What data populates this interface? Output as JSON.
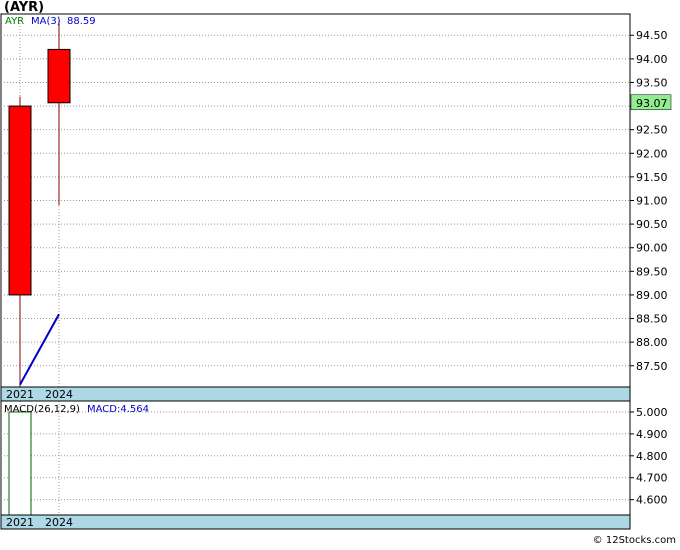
{
  "title": "(AYR)",
  "legend": {
    "ticker": "AYR",
    "ma_label": "MA(3)",
    "ma_value": "88.59",
    "macd_label": "MACD(26,12,9)",
    "macd_value_label": "MACD:4.564"
  },
  "footer": "© 12Stocks.com",
  "colors": {
    "candle_down": "#ff0000",
    "ma_line": "#0000cc",
    "band": "#add8e6",
    "last_price_bg": "#90ee90",
    "macd_bar": "#006400",
    "ticker_text": "#008000",
    "ma_text": "#0000cc"
  },
  "chart_data": [
    {
      "type": "candlestick",
      "categories": [
        "2021",
        "2024"
      ],
      "candles": [
        {
          "x": "2021",
          "open": 93.0,
          "high": 93.2,
          "low": 87.05,
          "close": 89.0
        },
        {
          "x": "2024",
          "open": 94.2,
          "high": 94.8,
          "low": 90.9,
          "close": 93.07
        }
      ],
      "ma": {
        "name": "MA(3)",
        "values": [
          87.1,
          88.59
        ]
      },
      "last_price": "93.07",
      "ylim": [
        87.05,
        94.95
      ],
      "yticks": [
        "87.50",
        "88.00",
        "88.50",
        "89.00",
        "89.50",
        "90.00",
        "90.50",
        "91.00",
        "91.50",
        "92.00",
        "92.50",
        "93.00",
        "93.50",
        "94.00",
        "94.50"
      ],
      "grid": true
    },
    {
      "type": "bar",
      "categories": [
        "2021",
        "2024"
      ],
      "values": [
        5.0,
        0
      ],
      "ylim": [
        4.53,
        5.05
      ],
      "yticks": [
        "4.600",
        "4.700",
        "4.800",
        "4.900",
        "5.000"
      ],
      "grid": true
    }
  ]
}
